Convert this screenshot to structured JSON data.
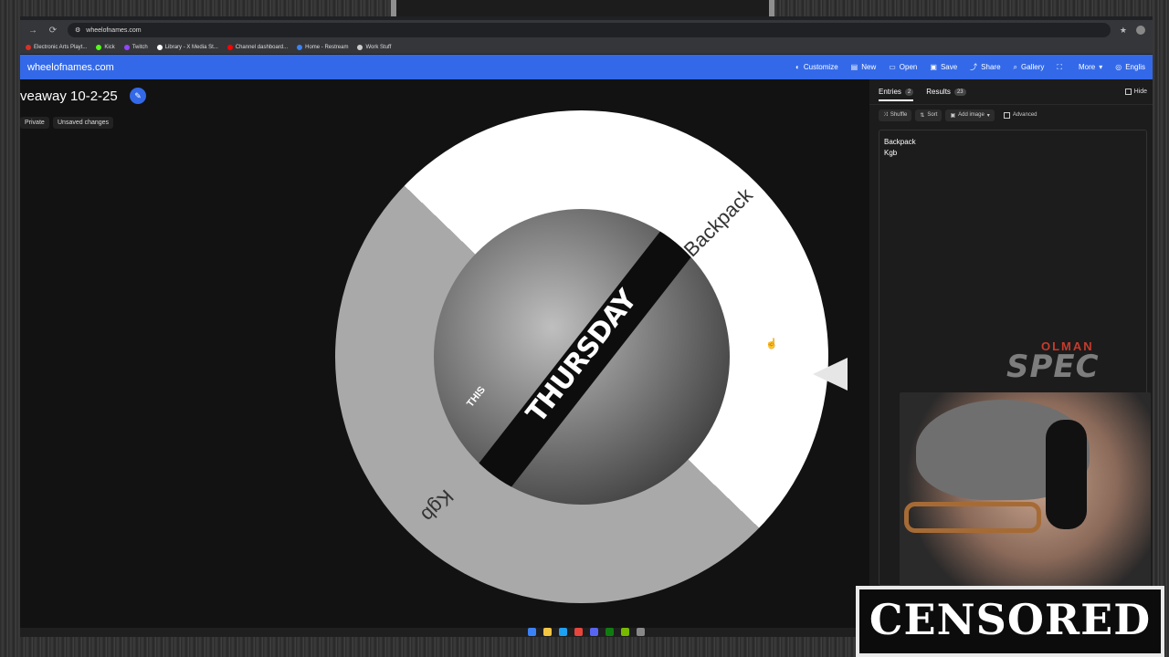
{
  "browser": {
    "url": "wheelofnames.com",
    "bookmarks": [
      {
        "label": "Electronic Arts Playt...",
        "color": "#d93025"
      },
      {
        "label": "Kick",
        "color": "#53fc18"
      },
      {
        "label": "Twitch",
        "color": "#9146ff"
      },
      {
        "label": "Library - X Media St...",
        "color": "#ffffff"
      },
      {
        "label": "Channel dashboard...",
        "color": "#ff0000"
      },
      {
        "label": "Home - Restream",
        "color": "#3b82f6"
      },
      {
        "label": "Work Stuff",
        "color": "#cccccc"
      }
    ]
  },
  "site": {
    "logo": "wheelofnames.com",
    "nav": [
      {
        "label": "Customize",
        "icon": "palette-icon"
      },
      {
        "label": "New",
        "icon": "new-file-icon"
      },
      {
        "label": "Open",
        "icon": "folder-icon"
      },
      {
        "label": "Save",
        "icon": "save-icon"
      },
      {
        "label": "Share",
        "icon": "share-icon"
      },
      {
        "label": "Gallery",
        "icon": "search-icon"
      },
      {
        "label": "",
        "icon": "fullscreen-icon"
      },
      {
        "label": "More",
        "icon": "chevron-down-icon"
      },
      {
        "label": "Englis",
        "icon": "globe-icon"
      }
    ]
  },
  "wheel": {
    "title": "veaway 10-2-25",
    "chips": [
      "Private",
      "Unsaved changes"
    ],
    "segments": [
      {
        "label": "Backpack",
        "color": "#ffffff"
      },
      {
        "label": "Kgb",
        "color": "#a9a9a9"
      }
    ],
    "center_text": "THURSDAY",
    "center_small": "THIS"
  },
  "panel": {
    "tabs": [
      {
        "label": "Entries",
        "count": "2"
      },
      {
        "label": "Results",
        "count": "23"
      }
    ],
    "hide_label": "Hide",
    "tools": [
      "Shuffle",
      "Sort",
      "Add image"
    ],
    "advanced_label": "Advanced",
    "entries": [
      "Backpack",
      "Kgb"
    ]
  },
  "overlay": {
    "logo_top": "OLMAN",
    "logo_main": "SPEC",
    "censored": "CENSORED"
  }
}
